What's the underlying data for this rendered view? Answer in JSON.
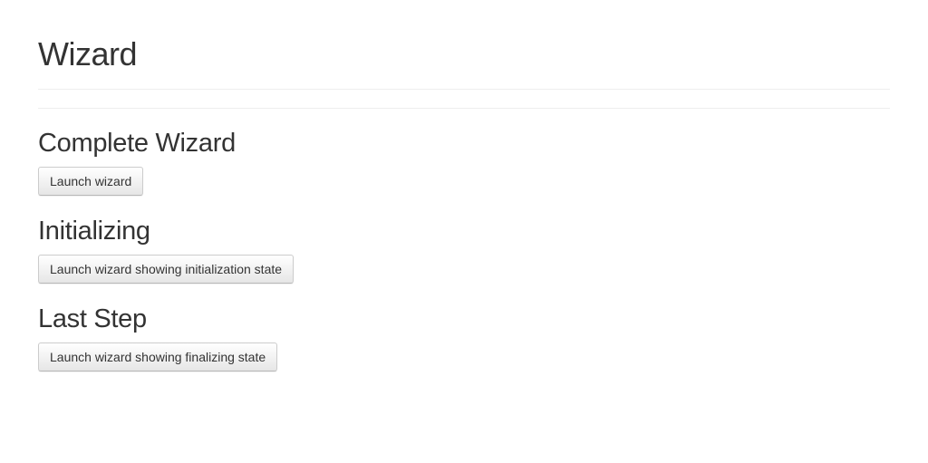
{
  "page": {
    "title": "Wizard"
  },
  "sections": [
    {
      "heading": "Complete Wizard",
      "button_label": "Launch wizard"
    },
    {
      "heading": "Initializing",
      "button_label": "Launch wizard showing initialization state"
    },
    {
      "heading": "Last Step",
      "button_label": "Launch wizard showing finalizing state"
    }
  ]
}
